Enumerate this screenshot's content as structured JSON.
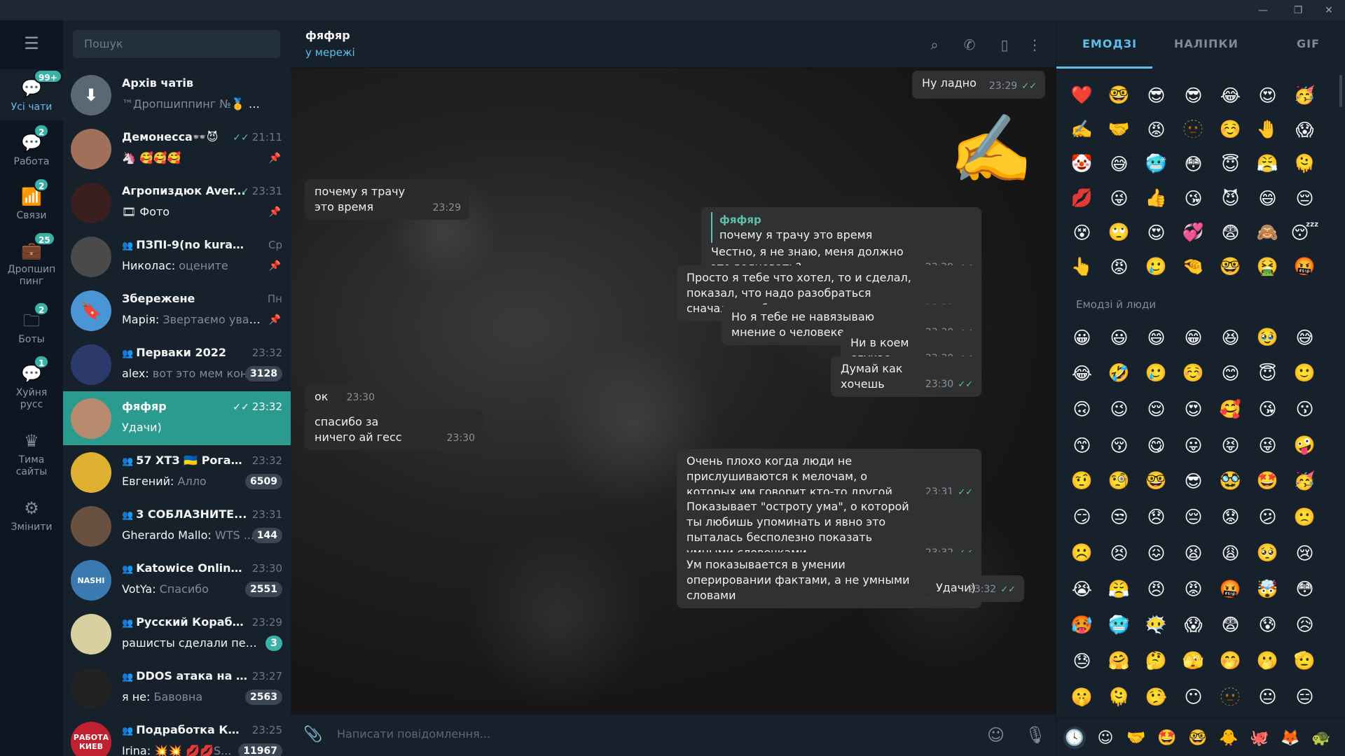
{
  "window": {
    "minimize_glyph": "—",
    "restore_glyph": "❐",
    "close_glyph": "✕"
  },
  "rail": {
    "menu_icon": "hamburger-icon",
    "folders": [
      {
        "label": "Усі чати",
        "badge": "99+",
        "icon": "chats-icon"
      },
      {
        "label": "Работа",
        "badge": "2",
        "icon": "chats-icon"
      },
      {
        "label": "Связи",
        "badge": "2",
        "icon": "graph-icon"
      },
      {
        "label": "Дропшип пинг",
        "badge": "25",
        "icon": "briefcase-icon"
      },
      {
        "label": "Боты",
        "badge": "2",
        "icon": "folder-icon"
      },
      {
        "label": "Хуйня русс",
        "badge": "1",
        "icon": "chat-icon"
      },
      {
        "label": "Тима сайты",
        "badge": "",
        "icon": "crown-icon"
      },
      {
        "label": "Змінити",
        "badge": "",
        "icon": "sliders-icon"
      }
    ]
  },
  "search": {
    "placeholder": "Пошук"
  },
  "chats": [
    {
      "name": "Архів чатів",
      "time": "",
      "sender": "",
      "preview": "™Дропшиппинг №🥇 iPh...",
      "badge": "",
      "pinned": false,
      "checks": "",
      "group": false
    },
    {
      "name": "Демонесса👓😈",
      "time": "21:11",
      "sender": "",
      "preview": "🦄 🥰🥰🥰",
      "badge": "",
      "pinned": true,
      "checks": "✓✓",
      "group": false
    },
    {
      "name": "Агропиздюк Aver...",
      "time": "23:31",
      "sender": "",
      "preview": "🎞 Фото",
      "badge": "",
      "pinned": true,
      "checks": "✓",
      "group": false
    },
    {
      "name": "ПЗПІ-9(no kurator)",
      "time": "Ср",
      "sender": "Николас:",
      "preview": "оцените",
      "badge": "",
      "pinned": true,
      "checks": "",
      "group": true
    },
    {
      "name": "Збережене",
      "time": "Пн",
      "sender": "Марія:",
      "preview": "Звертаємо увагу ...",
      "badge": "",
      "pinned": true,
      "checks": "",
      "group": false
    },
    {
      "name": "Перваки 2022",
      "time": "23:32",
      "sender": "alex:",
      "preview": "вот это мем кон...",
      "badge": "3128",
      "pinned": false,
      "checks": "",
      "group": true
    },
    {
      "name": "фяфяр",
      "time": "23:32",
      "sender": "",
      "preview": "Удачи)",
      "badge": "",
      "pinned": false,
      "checks": "✓✓",
      "group": false
    },
    {
      "name": "57 ХТЗ 🇺🇦 Рогань...",
      "time": "23:32",
      "sender": "Евгений:",
      "preview": "Алло",
      "badge": "6509",
      "pinned": false,
      "checks": "",
      "group": true
    },
    {
      "name": "3 СОБЛАЗНИТЕ...",
      "time": "23:31",
      "sender": "Gherardo Mallo:",
      "preview": "WTS ...",
      "badge": "144",
      "pinned": false,
      "checks": "",
      "group": true
    },
    {
      "name": "Katowice Online | ...",
      "time": "23:30",
      "sender": "VotYa:",
      "preview": "Спасибо",
      "badge": "2551",
      "pinned": false,
      "checks": "",
      "group": true
    },
    {
      "name": "Русский Корабль ...",
      "time": "23:29",
      "sender": "",
      "preview": "рашисты сделали пере...",
      "badge": "3",
      "pinned": false,
      "checks": "",
      "group": true
    },
    {
      "name": "DDOS атака на СЕ...",
      "time": "23:27",
      "sender": "я не:",
      "preview": "Бавовна",
      "badge": "2563",
      "pinned": false,
      "checks": "",
      "group": true
    },
    {
      "name": "Подработка КИЕВ",
      "time": "23:25",
      "sender": "Irina:",
      "preview": "💥💥 💋💋S...",
      "badge": "11967",
      "pinned": false,
      "checks": "",
      "group": true
    }
  ],
  "avatar_texts": [
    "",
    "",
    "",
    "",
    "",
    "",
    "",
    "",
    "",
    "NASHI",
    "",
    "",
    "РАБОТА КИЕВ"
  ],
  "header": {
    "name": "фяфяр",
    "status": "у мережі",
    "icons": [
      "search-icon",
      "phone-icon",
      "sidebar-icon",
      "more-icon"
    ]
  },
  "messages": [
    {
      "dir": "out",
      "text": "Ну ладно",
      "time": "23:29",
      "reply_name": "",
      "reply_text": ""
    },
    {
      "dir": "in",
      "text": "почему я трачу это время",
      "time": "23:29",
      "reply_name": "",
      "reply_text": ""
    },
    {
      "dir": "out",
      "text": "Честно, я не знаю, меня должно это волновать?",
      "time": "23:29",
      "reply_name": "фяфяр",
      "reply_text": "почему я трачу это время"
    },
    {
      "dir": "out",
      "text": "Просто я тебе что хотел, то и сделал, показал, что надо разобраться сначала в себе и в ситуации",
      "time": "23:30",
      "reply_name": "",
      "reply_text": ""
    },
    {
      "dir": "out",
      "text": "Но я тебе не навязываю мнение о человеке",
      "time": "23:30",
      "reply_name": "",
      "reply_text": ""
    },
    {
      "dir": "out",
      "text": "Ни в коем случае",
      "time": "23:30",
      "reply_name": "",
      "reply_text": ""
    },
    {
      "dir": "out",
      "text": "Думай как хочешь",
      "time": "23:30",
      "reply_name": "",
      "reply_text": ""
    },
    {
      "dir": "in",
      "text": "ок",
      "time": "23:30",
      "reply_name": "",
      "reply_text": ""
    },
    {
      "dir": "in",
      "text": "спасибо за ничего ай гесс",
      "time": "23:30",
      "reply_name": "",
      "reply_text": ""
    },
    {
      "dir": "out",
      "text": "Очень плохо когда люди не прислушиваются к мелочам, о которых им говорит кто-то другой",
      "time": "23:31",
      "reply_name": "",
      "reply_text": ""
    },
    {
      "dir": "out",
      "text": "Показывает \"остроту ума\", о которой ты любишь упоминать и явно это пыталась бесполезно показать умными словечками",
      "time": "23:32",
      "reply_name": "",
      "reply_text": ""
    },
    {
      "dir": "out",
      "text": "Ум показывается в умении оперировании фактами, а не умными словами",
      "time": "23:32",
      "reply_name": "",
      "reply_text": ""
    },
    {
      "dir": "out",
      "text": "Удачи)",
      "time": "23:32",
      "reply_name": "",
      "reply_text": ""
    }
  ],
  "sticker": "✍️",
  "composer": {
    "placeholder": "Написати повідомлення...",
    "attach_icon": "paperclip-icon",
    "emoji_icon": "smiley-icon",
    "mic_icon": "microphone-icon"
  },
  "emoji_panel": {
    "tabs": [
      "ЕМОДЗІ",
      "НАЛІПКИ",
      "GIF"
    ],
    "recent": [
      "❤️",
      "🤓",
      "😎",
      "😎",
      "😂",
      "😍",
      "🥳",
      "✍️",
      "🤝",
      "😡",
      "🫥",
      "☺️",
      "🤚",
      "😱",
      "🤡",
      "😅",
      "🥶",
      "😳",
      "😇",
      "😤",
      "🫠",
      "💋",
      "😜",
      "👍",
      "😘",
      "😈",
      "😄",
      "😔",
      "😵",
      "🙄",
      "😍",
      "💞",
      "😨",
      "🙈",
      "😴",
      "👆",
      "😡",
      "🥲",
      "🤏",
      "🤓",
      "🤮",
      "🤬"
    ],
    "section_title": "Емодзі й люди",
    "people": [
      "😀",
      "😃",
      "😄",
      "😁",
      "😆",
      "🥹",
      "😅",
      "😂",
      "🤣",
      "🥲",
      "☺️",
      "😊",
      "😇",
      "🙂",
      "🙃",
      "😉",
      "😌",
      "😍",
      "🥰",
      "😘",
      "😗",
      "😙",
      "😚",
      "😋",
      "😛",
      "😝",
      "😜",
      "🤪",
      "🤨",
      "🧐",
      "🤓",
      "😎",
      "🥸",
      "🤩",
      "🥳",
      "😏",
      "😒",
      "😞",
      "😔",
      "😟",
      "😕",
      "🙁",
      "☹️",
      "😣",
      "😖",
      "😫",
      "😩",
      "🥺",
      "😢",
      "😭",
      "😤",
      "😠",
      "😡",
      "🤬",
      "🤯",
      "😳",
      "🥵",
      "🥶",
      "😶‍🌫️",
      "😱",
      "😨",
      "😰",
      "😥",
      "😓",
      "🤗",
      "🤔",
      "🫣",
      "🤭",
      "🫢",
      "🫡",
      "🤫",
      "🫠",
      "🤥",
      "😶",
      "🫥",
      "😐",
      "😑"
    ],
    "footer_icons": [
      "🕓",
      "☺",
      "🤝",
      "🤩",
      "🤓",
      "🐥",
      "🐙",
      "🦊",
      "🐢"
    ]
  }
}
